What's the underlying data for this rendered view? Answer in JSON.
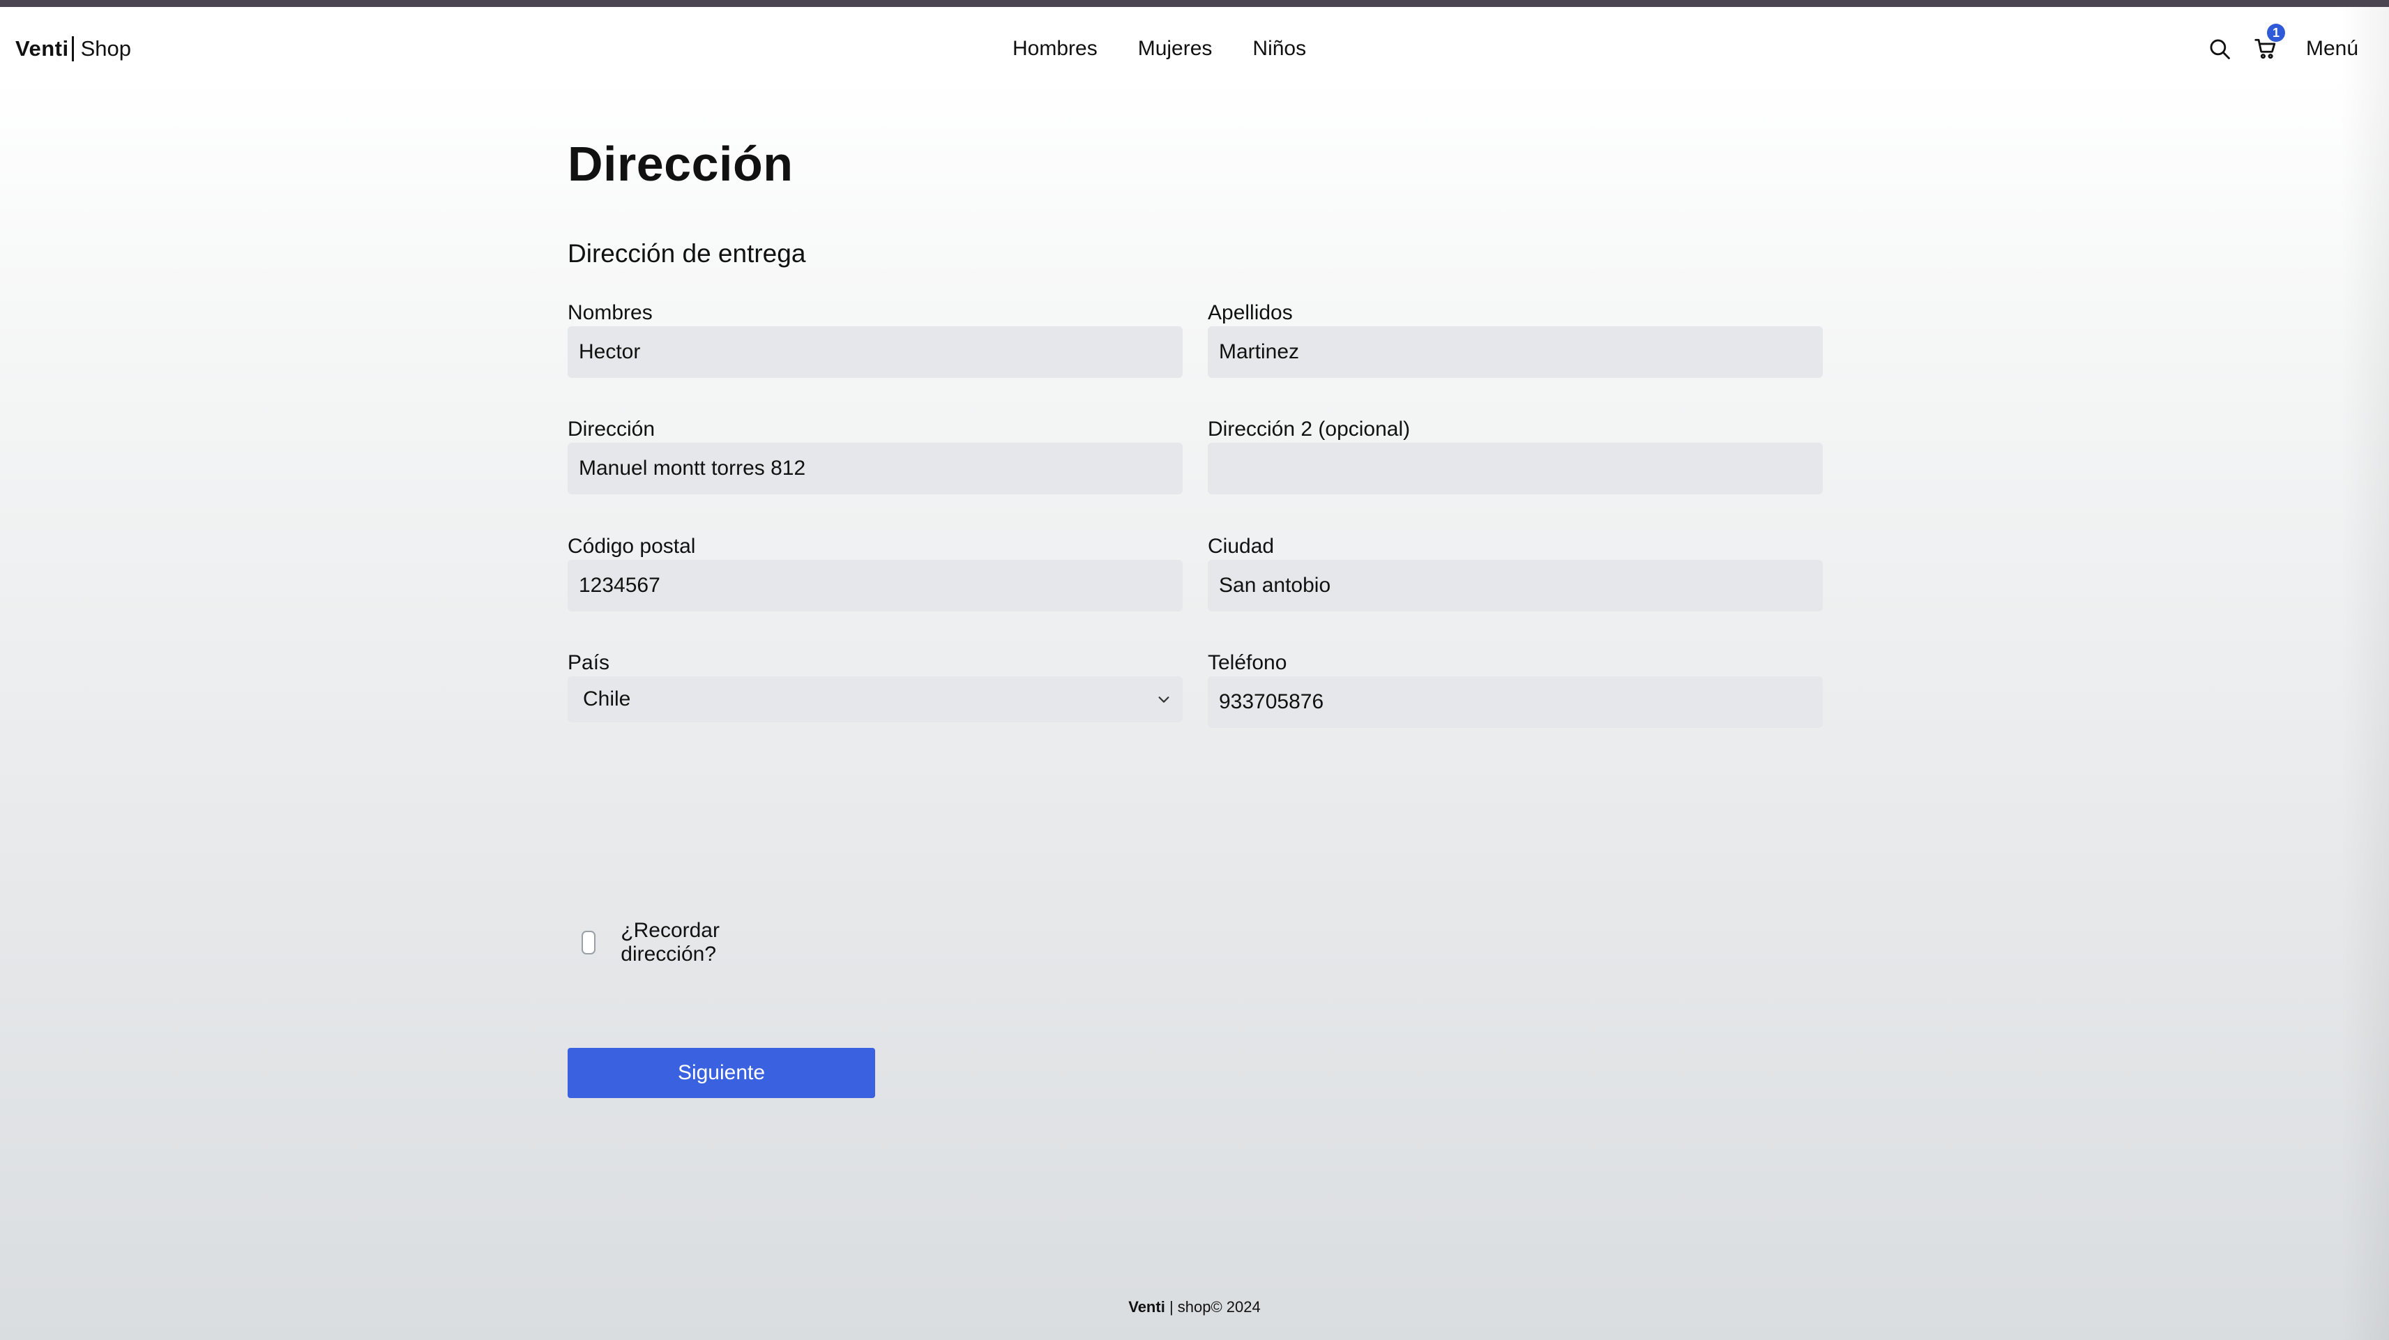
{
  "header": {
    "brand": "Venti",
    "shop": "Shop",
    "nav": [
      "Hombres",
      "Mujeres",
      "Niños"
    ],
    "cart_count": "1",
    "menu_label": "Menú"
  },
  "page": {
    "title": "Dirección",
    "subtitle": "Dirección de entrega"
  },
  "form": {
    "nombres": {
      "label": "Nombres",
      "value": "Hector"
    },
    "apellidos": {
      "label": "Apellidos",
      "value": "Martinez"
    },
    "direccion": {
      "label": "Dirección",
      "value": "Manuel montt torres 812"
    },
    "direccion2": {
      "label": "Dirección 2 (opcional)",
      "value": ""
    },
    "codigo_postal": {
      "label": "Código postal",
      "value": "1234567"
    },
    "ciudad": {
      "label": "Ciudad",
      "value": "San antobio"
    },
    "pais": {
      "label": "País",
      "value": "Chile"
    },
    "telefono": {
      "label": "Teléfono",
      "value": "933705876"
    },
    "remember_label": "¿Recordar dirección?",
    "remember_checked": false,
    "submit_label": "Siguiente"
  },
  "footer": {
    "brand": "Venti",
    "rest": "shop© 2024"
  },
  "colors": {
    "accent": "#3a62e0",
    "badge": "#2f5bd8",
    "input_bg": "#e6e7ea",
    "top_strip": "#4a4550"
  },
  "icons": {
    "search": "search-icon",
    "cart": "cart-icon",
    "select": "chevron-down-icon"
  }
}
